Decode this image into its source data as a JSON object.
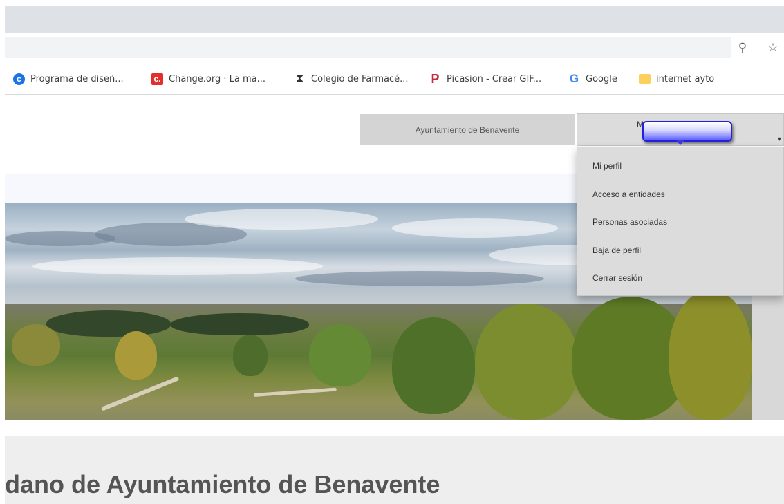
{
  "browser": {
    "toolbar_icons": [
      "zoom-icon",
      "star-icon"
    ],
    "bookmarks": [
      {
        "label": "Programa de diseñ...",
        "icon": "circle-c-icon"
      },
      {
        "label": "Change.org · La ma...",
        "icon": "change-org-icon"
      },
      {
        "label": "Colegio de Farmacé...",
        "icon": "hourglass-icon"
      },
      {
        "label": "Picasion - Crear GIF...",
        "icon": "picasion-icon"
      },
      {
        "label": "Google",
        "icon": "google-icon"
      },
      {
        "label": "internet ayto",
        "icon": "folder-icon"
      }
    ]
  },
  "header": {
    "entity_button": "Ayuntamiento de Benavente",
    "user_button_initial": "M",
    "user_menu": [
      "Mi perfil",
      "Acceso a entidades",
      "Personas asociadas",
      "Baja de perfil",
      "Cerrar sesión"
    ]
  },
  "main": {
    "title": "dano de Ayuntamiento de Benavente"
  },
  "colors": {
    "header_button_bg": "#d4d4d4",
    "menu_bg": "#dcdcdc",
    "content_band": "#eeeeee",
    "redaction_blue": "#5b5bff"
  }
}
